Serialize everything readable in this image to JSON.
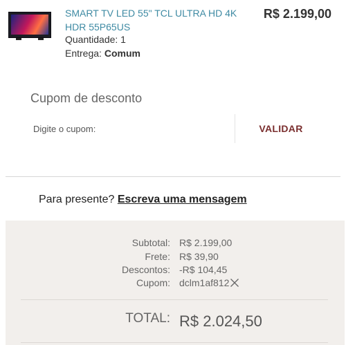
{
  "product": {
    "image_icon": "tv-thumbnail",
    "name": "SMART TV LED 55\" TCL ULTRA HD 4K HDR 55P65US",
    "quantity_label": "Quantidade: ",
    "quantity_value": "1",
    "delivery_label": "Entrega: ",
    "delivery_value": "Comum",
    "price": "R$ 2.199,00"
  },
  "coupon": {
    "title": "Cupom de desconto",
    "placeholder": "Digite o cupom:",
    "validate_label": "VALIDAR"
  },
  "gift": {
    "question": "Para presente? ",
    "link_label": "Escreva uma mensagem"
  },
  "summary": {
    "subtotal_label": "Subtotal:",
    "subtotal_value": "R$ 2.199,00",
    "shipping_label": "Frete:",
    "shipping_value": "R$ 39,90",
    "discount_label": "Descontos:",
    "discount_value": "-R$ 104,45",
    "coupon_label": "Cupom:",
    "coupon_value": "dclm1af812",
    "remove_icon": "close-icon",
    "total_label": "TOTAL:",
    "total_value": "R$ 2.024,50"
  },
  "colors": {
    "product_link": "#3e8aa3",
    "validate": "#7a2e2e",
    "summary_bg": "#f2efec"
  }
}
